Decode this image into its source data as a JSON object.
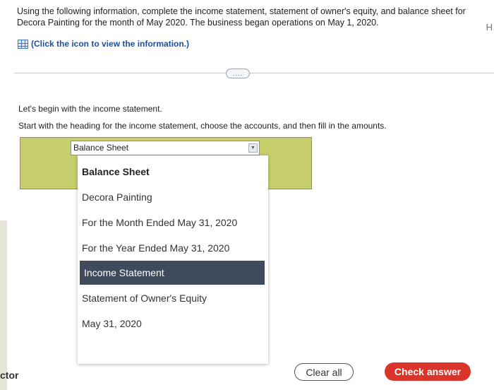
{
  "instructions": "Using the following information, complete the income statement, statement of owner's equity, and balance sheet for Decora Painting for the month of May 2020. The business began operations on May 1, 2020.",
  "info_link": {
    "icon": "table-icon",
    "label": "(Click the icon to view the information.)"
  },
  "expand_label": "....",
  "edge_letter": "H",
  "prompt_begin": "Let's begin with the income statement.",
  "prompt_heading": "Start with the heading for the income statement, choose the accounts, and then fill in the amounts.",
  "select": {
    "value": "Balance Sheet",
    "arrow": "▼",
    "options": [
      "Balance Sheet",
      "Decora Painting",
      "For the Month Ended May 31, 2020",
      "For the Year Ended May 31, 2020",
      "Income Statement",
      "Statement of Owner's Equity",
      "May 31, 2020"
    ],
    "highlighted_option": "Income Statement"
  },
  "footer": {
    "left_text": "ctor",
    "clear_label": "Clear all",
    "check_label": "Check answer"
  },
  "colors": {
    "answer_area": "#c6cf6b",
    "highlight": "#3f4a5c",
    "check_button": "#d9352b",
    "link": "#1f4fa0"
  }
}
